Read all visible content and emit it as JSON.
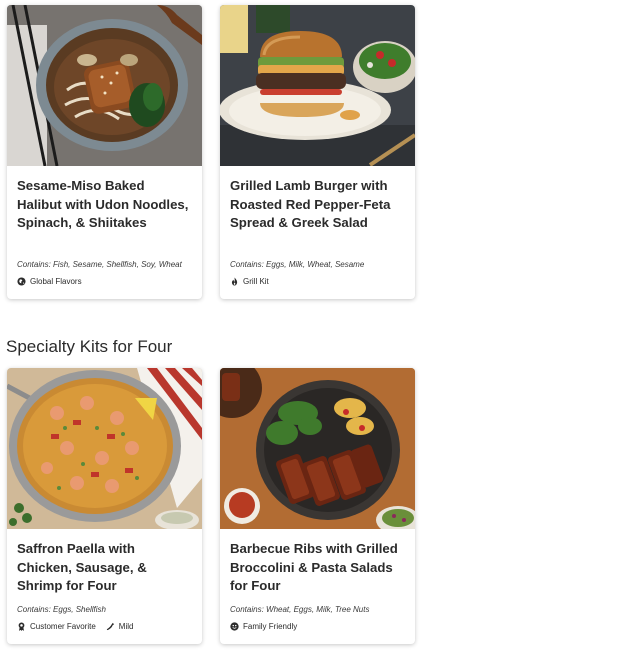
{
  "cards_top": [
    {
      "title": "Sesame-Miso Baked Halibut with Udon Noodles, Spinach, & Shiitakes",
      "contains_label": "Contains:",
      "contains": "Fish, Sesame, Shellfish, Soy, Wheat",
      "tags": [
        {
          "icon": "globe-icon",
          "label": "Global Flavors"
        }
      ]
    },
    {
      "title": "Grilled Lamb Burger with Roasted Red Pepper-Feta Spread & Greek Salad",
      "contains_label": "Contains:",
      "contains": "Eggs, Milk, Wheat, Sesame",
      "tags": [
        {
          "icon": "flame-icon",
          "label": "Grill Kit"
        }
      ]
    }
  ],
  "section": {
    "title": "Specialty Kits for Four"
  },
  "cards_bottom": [
    {
      "title": "Saffron Paella with Chicken, Sausage, & Shrimp for Four",
      "contains_label": "Contains:",
      "contains": "Eggs, Shellfish",
      "tags": [
        {
          "icon": "ribbon-icon",
          "label": "Customer Favorite"
        },
        {
          "icon": "pepper-icon",
          "label": "Mild"
        }
      ]
    },
    {
      "title": "Barbecue Ribs with Grilled Broccolini & Pasta Salads for Four",
      "contains_label": "Contains:",
      "contains": "Wheat, Eggs, Milk, Tree Nuts",
      "tags": [
        {
          "icon": "family-icon",
          "label": "Family Friendly"
        }
      ]
    }
  ]
}
